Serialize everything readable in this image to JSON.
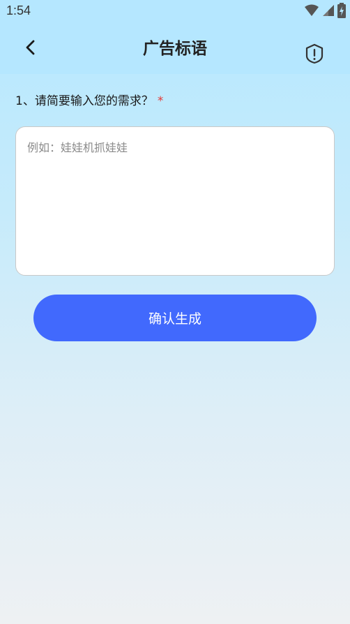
{
  "status_bar": {
    "time": "1:54",
    "icons": [
      "wifi-icon",
      "cellular-signal-icon",
      "battery-charging-icon"
    ]
  },
  "header": {
    "title": "广告标语",
    "back_icon": "chevron-left-icon",
    "action_icon": "shield-alert-icon"
  },
  "form": {
    "question": "1、请简要输入您的需求？",
    "required_mark": "*",
    "input_value": "",
    "input_placeholder": "例如：娃娃机抓娃娃",
    "submit_label": "确认生成"
  },
  "colors": {
    "header_bg": "#b5e7ff",
    "primary_button": "#4169fd",
    "required": "#e53935"
  }
}
